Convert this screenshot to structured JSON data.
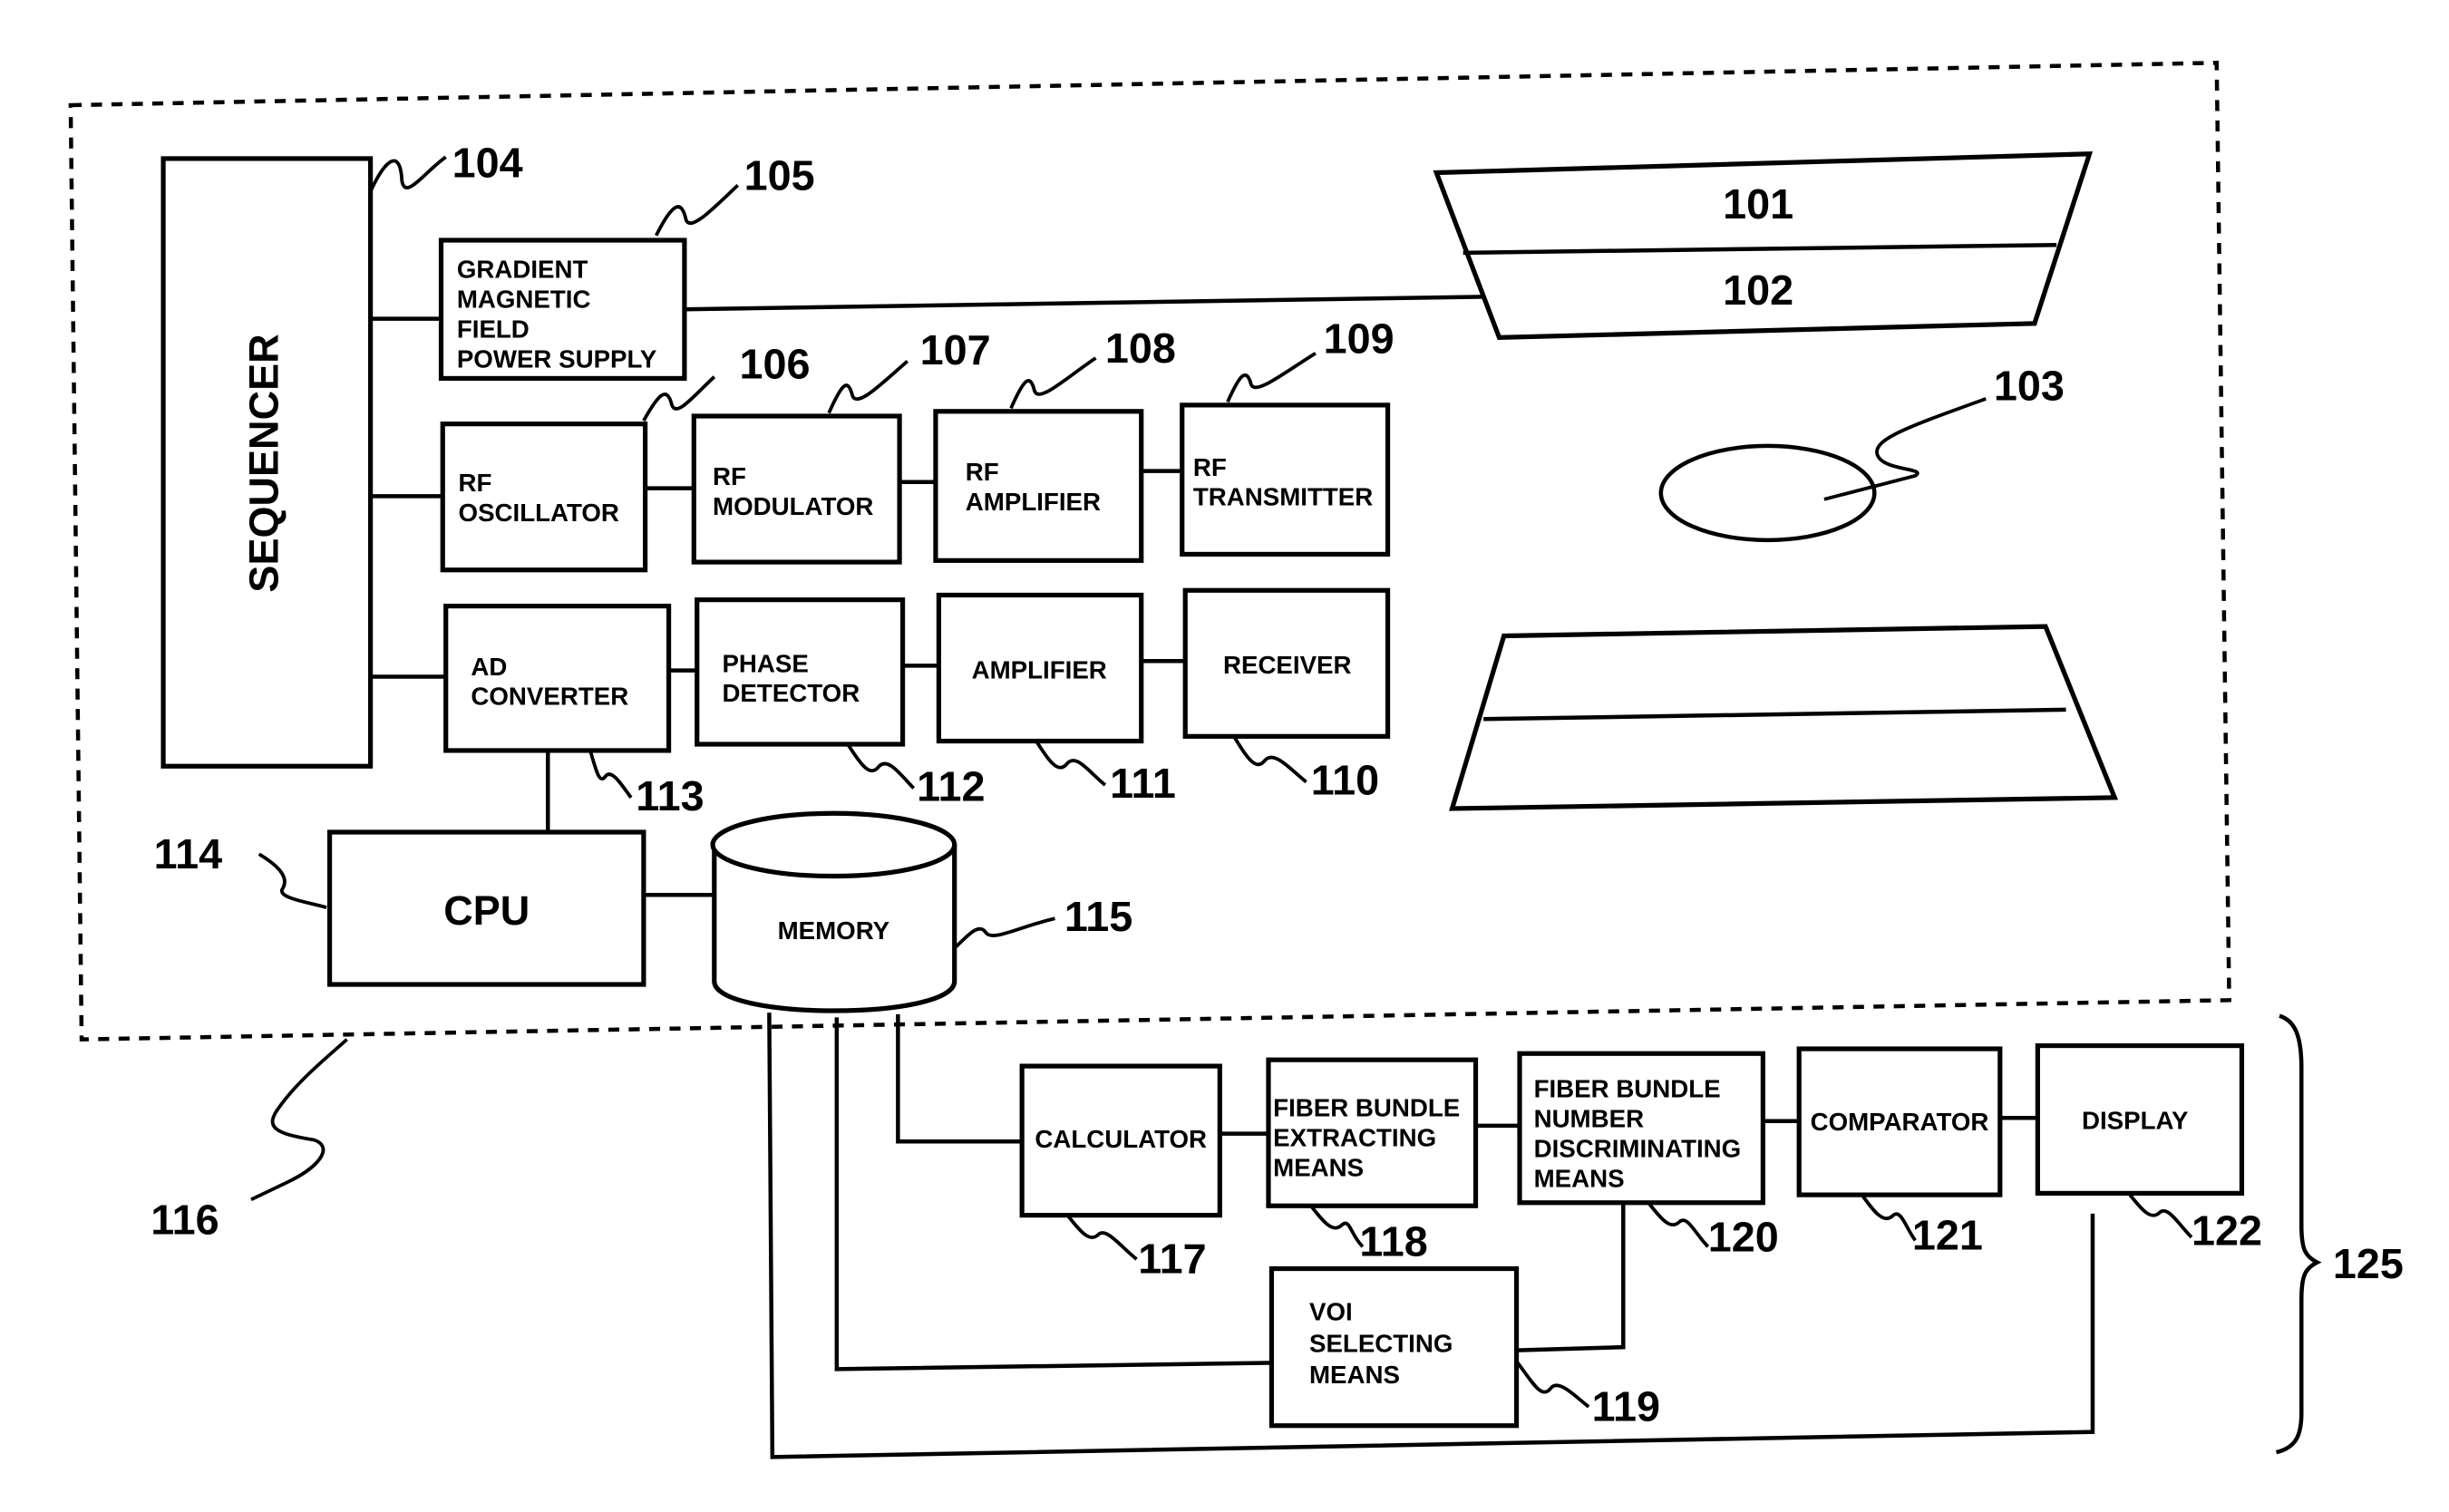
{
  "figure": {
    "outer_group_ref": "116",
    "processing_group_ref": "125"
  },
  "magnet": {
    "upper_top_ref": "101",
    "upper_bottom_ref": "102",
    "subject_ref": "103"
  },
  "blocks": {
    "sequencer": {
      "label": "SEQUENCER",
      "ref": "104"
    },
    "gradient_power": {
      "lines": [
        "GRADIENT",
        "MAGNETIC",
        "FIELD",
        "POWER SUPPLY"
      ],
      "ref": "105"
    },
    "rf_oscillator": {
      "lines": [
        "RF",
        "OSCILLATOR"
      ],
      "ref": "106"
    },
    "rf_modulator": {
      "lines": [
        "RF",
        "MODULATOR"
      ],
      "ref": "107"
    },
    "rf_amplifier": {
      "lines": [
        "RF",
        "AMPLIFIER"
      ],
      "ref": "108"
    },
    "rf_transmitter": {
      "lines": [
        "RF",
        "TRANSMITTER"
      ],
      "ref": "109"
    },
    "receiver": {
      "label": "RECEIVER",
      "ref": "110"
    },
    "amplifier": {
      "label": "AMPLIFIER",
      "ref": "111"
    },
    "phase_detector": {
      "lines": [
        "PHASE",
        "DETECTOR"
      ],
      "ref": "112"
    },
    "ad_converter": {
      "lines": [
        "AD",
        "CONVERTER"
      ],
      "ref": "113"
    },
    "cpu": {
      "label": "CPU",
      "ref": "114"
    },
    "memory": {
      "label": "MEMORY",
      "ref": "115"
    },
    "calculator": {
      "label": "CALCULATOR",
      "ref": "117"
    },
    "fiber_extracting": {
      "lines": [
        "FIBER BUNDLE",
        "EXTRACTING",
        "MEANS"
      ],
      "ref": "118"
    },
    "voi_selecting": {
      "lines": [
        "VOI",
        "SELECTING",
        "MEANS"
      ],
      "ref": "119"
    },
    "fiber_number": {
      "lines": [
        "FIBER BUNDLE",
        "NUMBER",
        "DISCRIMINATING",
        "MEANS"
      ],
      "ref": "120"
    },
    "comparator": {
      "label": "COMPARATOR",
      "ref": "121"
    },
    "display": {
      "label": "DISPLAY",
      "ref": "122"
    }
  }
}
